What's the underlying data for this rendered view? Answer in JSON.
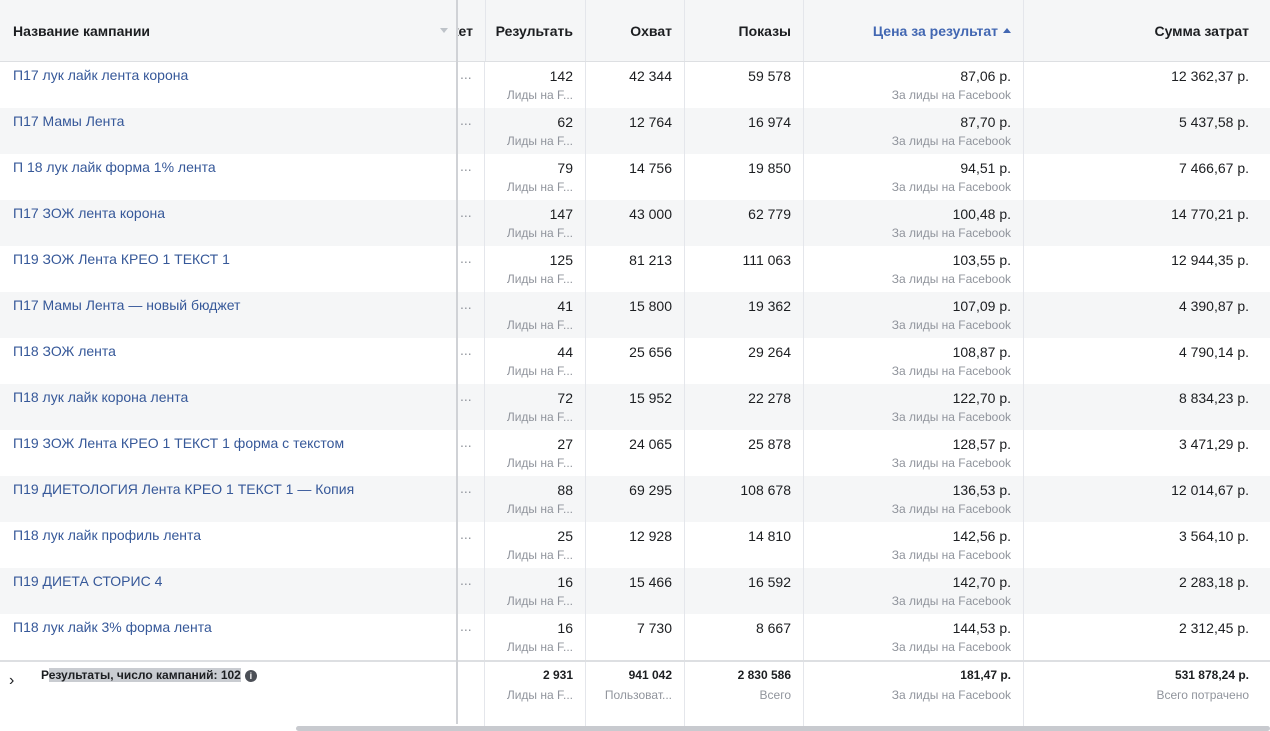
{
  "headers": {
    "name": "Название кампании",
    "budget_trunc": "жет",
    "results": "Результать",
    "reach": "Охват",
    "impressions": "Показы",
    "cpr": "Цена за результат",
    "spend": "Сумма затрат"
  },
  "rows": [
    {
      "name": "П17 лук лайк лента корона",
      "trunc": "...",
      "results": "142",
      "results_sub": "Лиды на F...",
      "reach": "42 344",
      "impressions": "59 578",
      "cpr": "87,06 р.",
      "cpr_sub": "За лиды на Facebook",
      "spend": "12 362,37 р."
    },
    {
      "name": "П17 Мамы Лента",
      "trunc": "...",
      "results": "62",
      "results_sub": "Лиды на F...",
      "reach": "12 764",
      "impressions": "16 974",
      "cpr": "87,70 р.",
      "cpr_sub": "За лиды на Facebook",
      "spend": "5 437,58 р."
    },
    {
      "name": "П 18 лук лайк форма 1% лента",
      "trunc": "...",
      "results": "79",
      "results_sub": "Лиды на F...",
      "reach": "14 756",
      "impressions": "19 850",
      "cpr": "94,51 р.",
      "cpr_sub": "За лиды на Facebook",
      "spend": "7 466,67 р."
    },
    {
      "name": "П17 ЗОЖ лента корона",
      "trunc": "...",
      "results": "147",
      "results_sub": "Лиды на F...",
      "reach": "43 000",
      "impressions": "62 779",
      "cpr": "100,48 р.",
      "cpr_sub": "За лиды на Facebook",
      "spend": "14 770,21 р."
    },
    {
      "name": "П19 ЗОЖ Лента КРЕО 1 ТЕКСТ 1",
      "trunc": "...",
      "results": "125",
      "results_sub": "Лиды на F...",
      "reach": "81 213",
      "impressions": "111 063",
      "cpr": "103,55 р.",
      "cpr_sub": "За лиды на Facebook",
      "spend": "12 944,35 р."
    },
    {
      "name": "П17 Мамы Лента — новый бюджет",
      "trunc": "...",
      "results": "41",
      "results_sub": "Лиды на F...",
      "reach": "15 800",
      "impressions": "19 362",
      "cpr": "107,09 р.",
      "cpr_sub": "За лиды на Facebook",
      "spend": "4 390,87 р."
    },
    {
      "name": "П18 ЗОЖ лента",
      "trunc": "...",
      "results": "44",
      "results_sub": "Лиды на F...",
      "reach": "25 656",
      "impressions": "29 264",
      "cpr": "108,87 р.",
      "cpr_sub": "За лиды на Facebook",
      "spend": "4 790,14 р."
    },
    {
      "name": "П18 лук лайк корона лента",
      "trunc": "...",
      "results": "72",
      "results_sub": "Лиды на F...",
      "reach": "15 952",
      "impressions": "22 278",
      "cpr": "122,70 р.",
      "cpr_sub": "За лиды на Facebook",
      "spend": "8 834,23 р."
    },
    {
      "name": "П19 ЗОЖ Лента КРЕО 1 ТЕКСТ 1 форма с текстом",
      "trunc": "...",
      "results": "27",
      "results_sub": "Лиды на F...",
      "reach": "24 065",
      "impressions": "25 878",
      "cpr": "128,57 р.",
      "cpr_sub": "За лиды на Facebook",
      "spend": "3 471,29 р."
    },
    {
      "name": "П19 ДИЕТОЛОГИЯ Лента КРЕО 1 ТЕКСТ 1 — Копия",
      "trunc": "...",
      "results": "88",
      "results_sub": "Лиды на F...",
      "reach": "69 295",
      "impressions": "108 678",
      "cpr": "136,53 р.",
      "cpr_sub": "За лиды на Facebook",
      "spend": "12 014,67 р."
    },
    {
      "name": "П18 лук лайк профиль лента",
      "trunc": "...",
      "results": "25",
      "results_sub": "Лиды на F...",
      "reach": "12 928",
      "impressions": "14 810",
      "cpr": "142,56 р.",
      "cpr_sub": "За лиды на Facebook",
      "spend": "3 564,10 р."
    },
    {
      "name": "П19 ДИЕТА СТОРИС 4",
      "trunc": "...",
      "results": "16",
      "results_sub": "Лиды на F...",
      "reach": "15 466",
      "impressions": "16 592",
      "cpr": "142,70 р.",
      "cpr_sub": "За лиды на Facebook",
      "spend": "2 283,18 р."
    },
    {
      "name": "П18 лук лайк 3% форма лента",
      "trunc": "...",
      "results": "16",
      "results_sub": "Лиды на F...",
      "reach": "7 730",
      "impressions": "8 667",
      "cpr": "144,53 р.",
      "cpr_sub": "За лиды на Facebook",
      "spend": "2 312,45 р."
    }
  ],
  "footer": {
    "label_prefix": "Р",
    "label_highlight": "езультаты, число кампаний: 102",
    "results": "2 931",
    "results_sub": "Лиды на F...",
    "reach": "941 042",
    "reach_sub": "Пользоват...",
    "impressions": "2 830 586",
    "impressions_sub": "Всего",
    "cpr": "181,47 р.",
    "cpr_sub": "За лиды на Facebook",
    "spend": "531 878,24 р.",
    "spend_sub": "Всего потрачено"
  },
  "colors": {
    "link": "#365899",
    "sorted_header": "#4267b2",
    "muted": "#90949c"
  }
}
